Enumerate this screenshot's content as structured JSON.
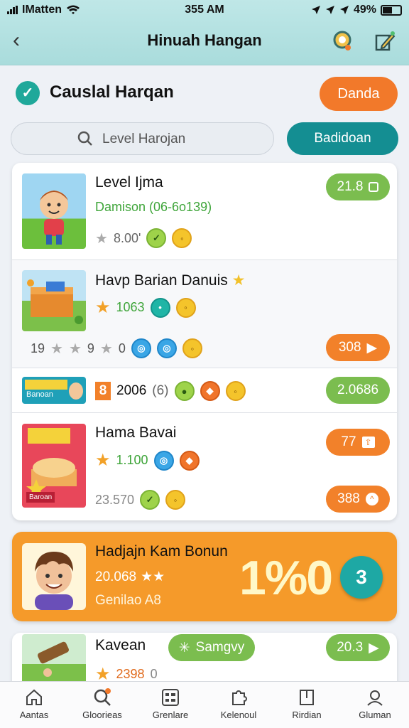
{
  "status": {
    "carrier": "IMatten",
    "time": "355 AM",
    "battery": "49%"
  },
  "header": {
    "title": "Hinuah Hangan"
  },
  "section": {
    "title": "Causlal Harqan",
    "action_label": "Danda"
  },
  "search": {
    "placeholder": "Level Harojan",
    "button_label": "Badidoan"
  },
  "items": [
    {
      "title": "Level Ijma",
      "subtitle": "Damison (06-6o139)",
      "meta": "8.00'",
      "action": "21.8"
    },
    {
      "title": "Havp Barian Danuis",
      "subtitle": "1063",
      "meta_left": "19",
      "meta_mid": "9",
      "meta_right": "0",
      "action": "308"
    },
    {
      "badge": "8",
      "value": "2006",
      "suffix": "(6)",
      "thumb_text": "Banoan",
      "action": "2.0686"
    },
    {
      "title": "Hama Bavai",
      "subtitle": "1.100",
      "meta": "23.570",
      "thumb_text": "Baroan",
      "action_top": "77",
      "action_bottom": "388"
    }
  ],
  "featured": {
    "title": "Hadjajn Kam Bonun",
    "value": "20.068",
    "subtitle": "Genilao A8",
    "big_text": "1%0",
    "fab_label": "3"
  },
  "last_item": {
    "title": "Kavean",
    "subtitle": "2398",
    "suffix": "0",
    "chip_label": "Samgvy",
    "action": "20.3"
  },
  "nav": [
    {
      "label": "Aantas",
      "icon": "home-icon"
    },
    {
      "label": "Gloorieas",
      "icon": "search-icon"
    },
    {
      "label": "Grenlare",
      "icon": "grid-icon"
    },
    {
      "label": "Kelenoul",
      "icon": "puzzle-icon"
    },
    {
      "label": "Rirdian",
      "icon": "book-icon"
    },
    {
      "label": "Gluman",
      "icon": "profile-icon"
    }
  ]
}
